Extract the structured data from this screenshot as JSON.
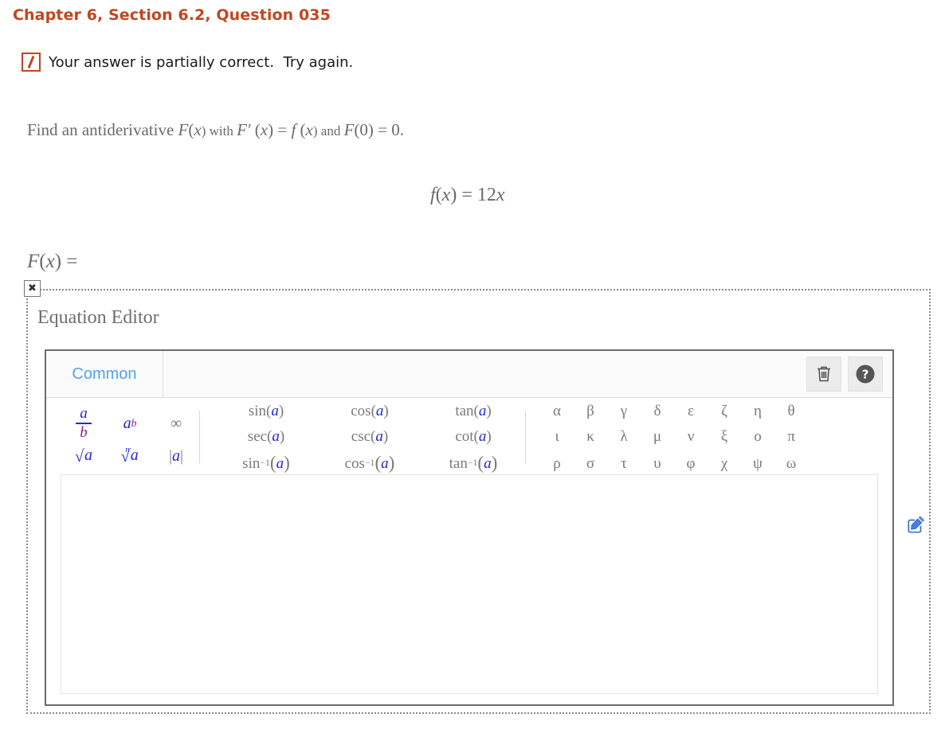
{
  "header": {
    "question_title": "Chapter 6, Section 6.2, Question 035",
    "title_color": "#c1461f",
    "feedback_icon": "partially-correct-slash-icon",
    "feedback_text": "Your answer is partially correct.  Try again."
  },
  "problem": {
    "instruction_parts": {
      "p1": "Find an antiderivative ",
      "f_of_x": "F",
      "p2": "(",
      "x1": "x",
      "p3": ") with ",
      "fprime": "F′",
      "p4": " (",
      "x2": "x",
      "p5": ") = ",
      "lower_f": "f",
      "p6": " (",
      "x3": "x",
      "p7": ") and ",
      "F2": "F",
      "p8": "(0) = 0."
    },
    "instruction_plain": "Find an antiderivative F(x) with F′ (x) = f (x) and F(0) = 0.",
    "given_equation": "f(x) = 12x",
    "answer_prompt": "F(x) ="
  },
  "equation_editor": {
    "close_button_label": "✖",
    "panel_title": "Equation Editor",
    "tabs": [
      {
        "label": "Common",
        "active": true,
        "color": "#4da3f5"
      }
    ],
    "tools": [
      {
        "name": "delete-button",
        "icon": "trash-icon",
        "label": ""
      },
      {
        "name": "help-button",
        "icon": "question-circle-icon",
        "label": ""
      }
    ],
    "palette": {
      "basics": [
        {
          "id": "fraction",
          "num": "a",
          "den": "b",
          "label": "a/b"
        },
        {
          "id": "power",
          "base": "a",
          "exp": "b",
          "label": "a^b"
        },
        {
          "id": "infinity",
          "label": "∞"
        },
        {
          "id": "sqrt",
          "label": "√a",
          "radicand": "a"
        },
        {
          "id": "nth-root",
          "label": "ⁿ√a",
          "index": "n",
          "radicand": "a"
        },
        {
          "id": "absolute-value",
          "label": "|a|",
          "arg": "a"
        }
      ],
      "trig": [
        {
          "id": "sin",
          "name": "sin",
          "arg": "a",
          "inverse": false
        },
        {
          "id": "cos",
          "name": "cos",
          "arg": "a",
          "inverse": false
        },
        {
          "id": "tan",
          "name": "tan",
          "arg": "a",
          "inverse": false
        },
        {
          "id": "sec",
          "name": "sec",
          "arg": "a",
          "inverse": false
        },
        {
          "id": "csc",
          "name": "csc",
          "arg": "a",
          "inverse": false
        },
        {
          "id": "cot",
          "name": "cot",
          "arg": "a",
          "inverse": false
        },
        {
          "id": "arcsin",
          "name": "sin",
          "arg": "a",
          "inverse": true
        },
        {
          "id": "arccos",
          "name": "cos",
          "arg": "a",
          "inverse": true
        },
        {
          "id": "arctan",
          "name": "tan",
          "arg": "a",
          "inverse": true
        }
      ],
      "greek": [
        "α",
        "β",
        "γ",
        "δ",
        "ε",
        "ζ",
        "η",
        "θ",
        "ι",
        "κ",
        "λ",
        "μ",
        "ν",
        "ξ",
        "ο",
        "π",
        "ρ",
        "σ",
        "τ",
        "υ",
        "φ",
        "χ",
        "ψ",
        "ω"
      ],
      "greek_names": [
        "alpha",
        "beta",
        "gamma",
        "delta",
        "epsilon",
        "zeta",
        "eta",
        "theta",
        "iota",
        "kappa",
        "lambda",
        "mu",
        "nu",
        "xi",
        "omicron",
        "pi",
        "rho",
        "sigma",
        "tau",
        "upsilon",
        "phi",
        "chi",
        "psi",
        "omega"
      ]
    },
    "input": {
      "value": "",
      "placeholder": ""
    },
    "side_edit_icon": "edit-pencil-square-icon"
  },
  "colors": {
    "accent_red": "#c1461f",
    "tab_blue": "#4da3f5",
    "math_gray": "#7a7a7a",
    "var_blue": "#2525dd",
    "var_purple": "#8b1f8b",
    "panel_border": "#6c6c6c"
  }
}
